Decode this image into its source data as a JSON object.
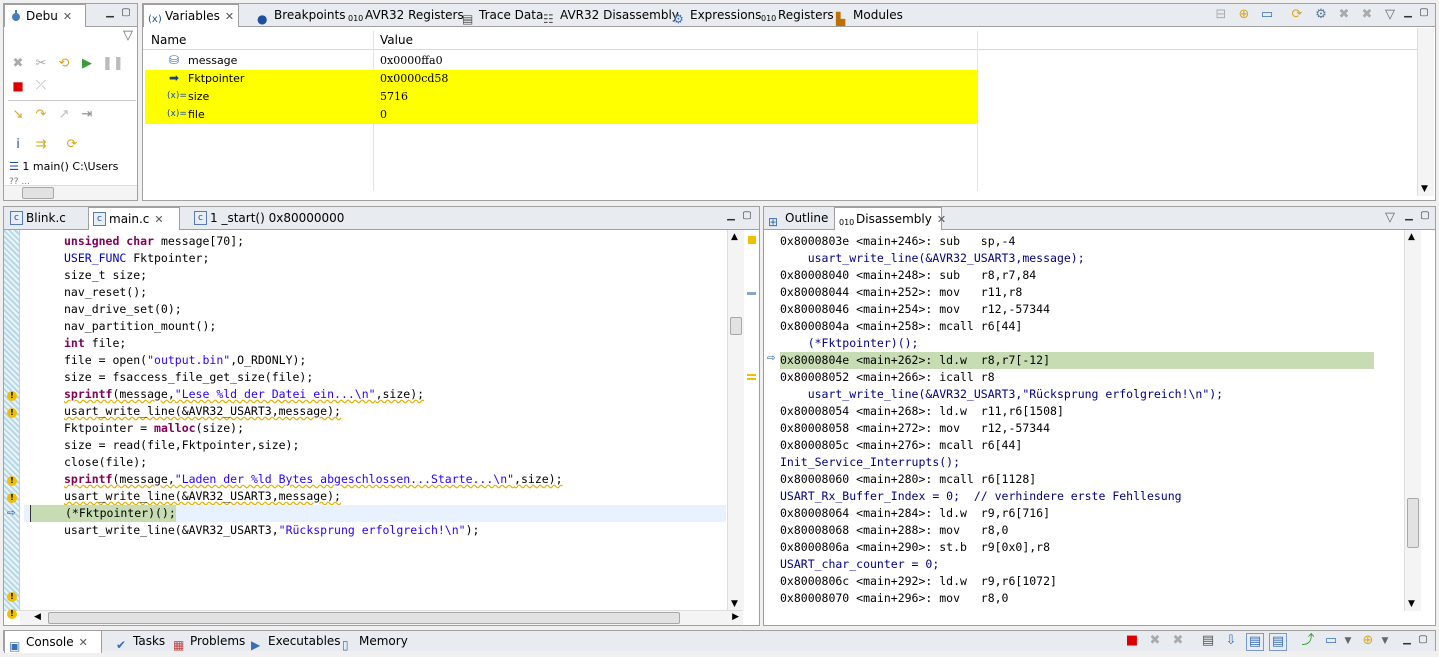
{
  "debug_view": {
    "tab_label": "Debu",
    "stack_entry": "1 main() C:\\Users",
    "stack_entry2": "?? ..."
  },
  "variables_view": {
    "tabs": [
      {
        "label": "Variables",
        "icon": "variables-icon"
      },
      {
        "label": "Breakpoints",
        "icon": "breakpoints-icon"
      },
      {
        "label": "AVR32 Registers",
        "icon": "registers-icon"
      },
      {
        "label": "Trace Data",
        "icon": "trace-icon"
      },
      {
        "label": "AVR32 Disassembly",
        "icon": "disassembly-icon"
      },
      {
        "label": "Expressions",
        "icon": "expressions-icon"
      },
      {
        "label": "Registers",
        "icon": "registers-icon"
      },
      {
        "label": "Modules",
        "icon": "modules-icon"
      }
    ],
    "columns": [
      "Name",
      "Value"
    ],
    "rows": [
      {
        "name": "message",
        "value": "0x0000ffa0",
        "highlight": false
      },
      {
        "name": "Fktpointer",
        "value": "0x0000cd58",
        "highlight": true
      },
      {
        "name": "size",
        "value": "5716",
        "highlight": true
      },
      {
        "name": "file",
        "value": "0",
        "highlight": true
      }
    ]
  },
  "editor": {
    "tabs": [
      {
        "label": "Blink.c"
      },
      {
        "label": "main.c"
      },
      {
        "label": "1 _start() 0x80000000"
      }
    ],
    "lines": [
      "unsigned char message[70];",
      "USER_FUNC Fktpointer;",
      "size_t size;",
      "nav_reset();",
      "nav_drive_set(0);",
      "nav_partition_mount();",
      "int file;",
      "file = open(\"output.bin\",O_RDONLY);",
      "size = fsaccess_file_get_size(file);",
      "sprintf(message,\"Lese %ld der Datei ein...\\n\",size);",
      "usart_write_line(&AVR32_USART3,message);",
      "Fktpointer = malloc(size);",
      "size = read(file,Fktpointer,size);",
      "close(file);",
      "sprintf(message,\"Laden der %ld Bytes abgeschlossen...Starte...\\n\",size);",
      "usart_write_line(&AVR32_USART3,message);",
      "(*Fktpointer)();",
      "usart_write_line(&AVR32_USART3,\"Rücksprung erfolgreich!\\n\");"
    ]
  },
  "disassembly_view": {
    "tabs": [
      {
        "label": "Outline"
      },
      {
        "label": "Disassembly"
      }
    ],
    "lines": [
      "0x8000803e <main+246>: sub   sp,-4",
      "    usart_write_line(&AVR32_USART3,message);",
      "0x80008040 <main+248>: sub   r8,r7,84",
      "0x80008044 <main+252>: mov   r11,r8",
      "0x80008046 <main+254>: mov   r12,-57344",
      "0x8000804a <main+258>: mcall r6[44]",
      "    (*Fktpointer)();",
      "0x8000804e <main+262>: ld.w  r8,r7[-12]",
      "0x80008052 <main+266>: icall r8",
      "    usart_write_line(&AVR32_USART3,\"Rücksprung erfolgreich!\\n\");",
      "0x80008054 <main+268>: ld.w  r11,r6[1508]",
      "0x80008058 <main+272>: mov   r12,-57344",
      "0x8000805c <main+276>: mcall r6[44]",
      "Init_Service_Interrupts();",
      "0x80008060 <main+280>: mcall r6[1128]",
      "USART_Rx_Buffer_Index = 0;  // verhindere erste Fehllesung",
      "0x80008064 <main+284>: ld.w  r9,r6[716]",
      "0x80008068 <main+288>: mov   r8,0",
      "0x8000806a <main+290>: st.b  r9[0x0],r8",
      "USART_char_counter = 0;",
      "0x8000806c <main+292>: ld.w  r9,r6[1072]",
      "0x80008070 <main+296>: mov   r8,0"
    ]
  },
  "bottom_bar": {
    "tabs": [
      {
        "label": "Console"
      },
      {
        "label": "Tasks"
      },
      {
        "label": "Problems"
      },
      {
        "label": "Executables"
      },
      {
        "label": "Memory"
      }
    ]
  },
  "colors": {
    "highlight_yellow": "#ffff00",
    "current_line_green": "#c8dcb4",
    "keyword": "#7f0055",
    "string": "#2a00ff"
  }
}
